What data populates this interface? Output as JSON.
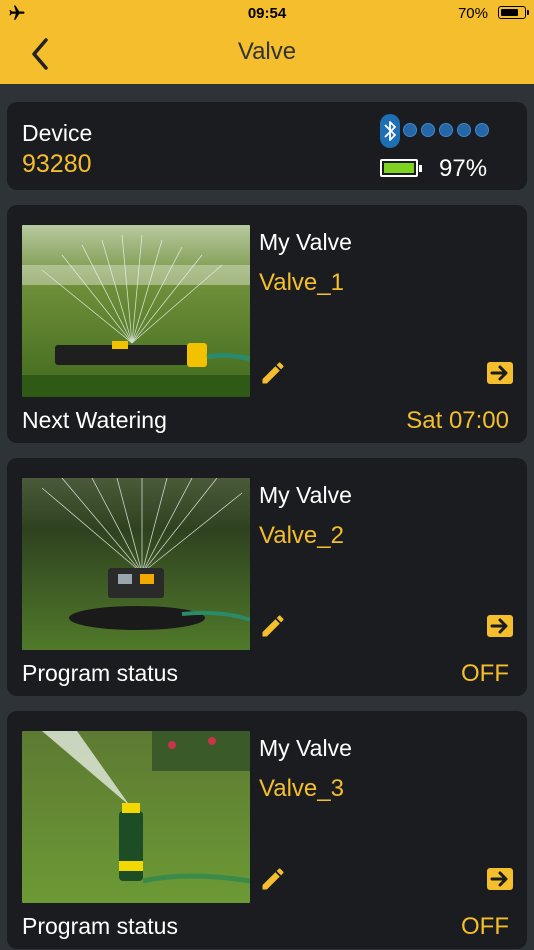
{
  "status_bar": {
    "time": "09:54",
    "battery_pct": "70%",
    "battery_level": 0.7
  },
  "nav": {
    "title": "Valve"
  },
  "device": {
    "label": "Device",
    "id": "93280",
    "battery_pct": "97%",
    "signal_dots": 5,
    "colors": {
      "accent": "#f4be2c",
      "battery": "#7ed321",
      "bluetooth": "#1f6fb5"
    }
  },
  "valves": [
    {
      "title": "My Valve",
      "name": "Valve_1",
      "status_label": "Next Watering",
      "status_value": "Sat 07:00"
    },
    {
      "title": "My Valve",
      "name": "Valve_2",
      "status_label": "Program status",
      "status_value": "OFF"
    },
    {
      "title": "My Valve",
      "name": "Valve_3",
      "status_label": "Program status",
      "status_value": "OFF"
    }
  ]
}
